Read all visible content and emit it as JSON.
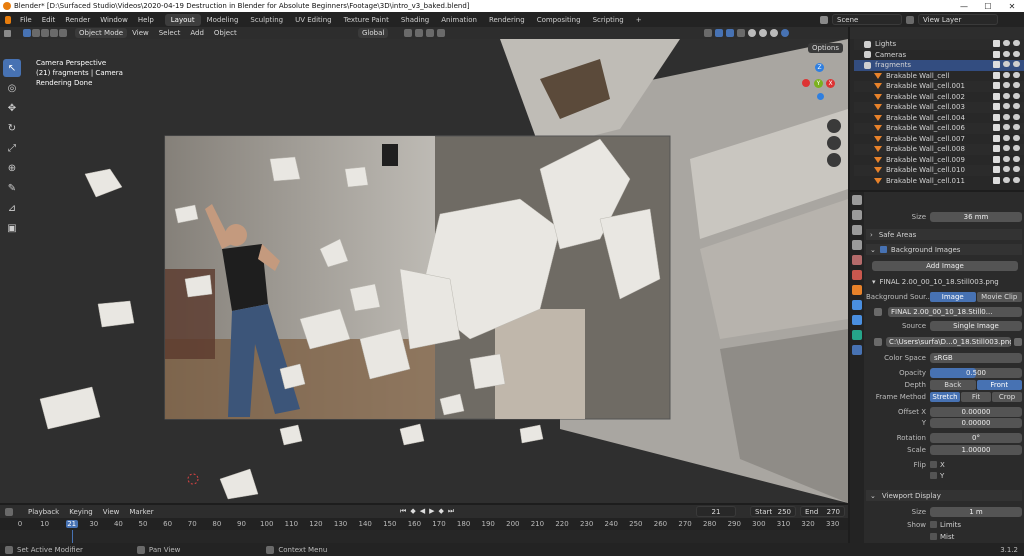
{
  "title_bar": {
    "text": "Blender* [D:\\Surfaced Studio\\Videos\\2020-04-19 Destruction in Blender for Absolute Beginners\\Footage\\3D\\intro_v3_baked.blend]",
    "minimize": "—",
    "maximize": "☐",
    "close": "✕"
  },
  "menu": [
    "File",
    "Edit",
    "Render",
    "Window",
    "Help"
  ],
  "workspaces": [
    "Layout",
    "Modeling",
    "Sculpting",
    "UV Editing",
    "Texture Paint",
    "Shading",
    "Animation",
    "Rendering",
    "Compositing",
    "Scripting"
  ],
  "workspace_add": "+",
  "scene": "Scene",
  "view_layer": "View Layer",
  "viewport_header": {
    "mode": "Object Mode",
    "menus": [
      "View",
      "Select",
      "Add",
      "Object"
    ],
    "transform": "Global",
    "options": "Options"
  },
  "viewport_overlay": {
    "line1": "Camera Perspective",
    "line2": "(21) fragments | Camera",
    "line3": "Rendering Done"
  },
  "gizmo": {
    "z": "Z",
    "y": "Y",
    "x": "X"
  },
  "outliner": {
    "rows": [
      {
        "label": "Lights",
        "type": "collection"
      },
      {
        "label": "Cameras",
        "type": "collection"
      },
      {
        "label": "fragments",
        "type": "collection",
        "selected": true
      },
      {
        "label": "Brakable Wall_cell",
        "type": "mesh"
      },
      {
        "label": "Brakable Wall_cell.001",
        "type": "mesh"
      },
      {
        "label": "Brakable Wall_cell.002",
        "type": "mesh"
      },
      {
        "label": "Brakable Wall_cell.003",
        "type": "mesh"
      },
      {
        "label": "Brakable Wall_cell.004",
        "type": "mesh"
      },
      {
        "label": "Brakable Wall_cell.006",
        "type": "mesh"
      },
      {
        "label": "Brakable Wall_cell.007",
        "type": "mesh"
      },
      {
        "label": "Brakable Wall_cell.008",
        "type": "mesh"
      },
      {
        "label": "Brakable Wall_cell.009",
        "type": "mesh"
      },
      {
        "label": "Brakable Wall_cell.010",
        "type": "mesh"
      },
      {
        "label": "Brakable Wall_cell.011",
        "type": "mesh"
      }
    ]
  },
  "properties": {
    "size_label": "Size",
    "size_value": "36 mm",
    "safe_areas": "Safe Areas",
    "background_images": "Background Images",
    "add_image": "Add Image",
    "image_name": "FINAL 2.00_00_10_18.Still003.png",
    "background_source_label": "Background Sour...",
    "bg_source_options": [
      "Image",
      "Movie Clip"
    ],
    "image_block": "FINAL 2.00_00_10_18.Still0...",
    "source_label": "Source",
    "source_value": "Single Image",
    "filepath": "C:\\Users\\surfa\\D...0_18.Still003.png",
    "color_space_label": "Color Space",
    "color_space_value": "sRGB",
    "opacity_label": "Opacity",
    "opacity_value": "0.500",
    "opacity": 0.5,
    "depth_label": "Depth",
    "depth_options": [
      "Back",
      "Front"
    ],
    "frame_method_label": "Frame Method",
    "frame_method_options": [
      "Stretch",
      "Fit",
      "Crop"
    ],
    "offset_x_label": "Offset X",
    "offset_x_value": "0.00000",
    "offset_y_label": "Y",
    "offset_y_value": "0.00000",
    "rotation_label": "Rotation",
    "rotation_value": "0°",
    "scale_label": "Scale",
    "scale_value": "1.00000",
    "flip_label": "Flip",
    "flip_x": "X",
    "flip_y": "Y",
    "viewport_display": "Viewport Display",
    "vd_size_label": "Size",
    "vd_size_value": "1 m",
    "show_label": "Show",
    "limits": "Limits",
    "mist": "Mist"
  },
  "timeline": {
    "menus": [
      "Playback",
      "Keying",
      "View",
      "Marker"
    ],
    "current_frame": "21",
    "start_label": "Start",
    "start": "250",
    "end_label": "End",
    "end": "270",
    "ticks": [
      "0",
      "10",
      "21",
      "30",
      "40",
      "50",
      "60",
      "70",
      "80",
      "90",
      "100",
      "110",
      "120",
      "130",
      "140",
      "150",
      "160",
      "170",
      "180",
      "190",
      "200",
      "210",
      "220",
      "230",
      "240",
      "250",
      "260",
      "270",
      "280",
      "290",
      "300",
      "310",
      "320",
      "330"
    ]
  },
  "status_bar": {
    "left": "Set Active Modifier",
    "middle": "Pan View",
    "right": "Context Menu",
    "version": "3.1.2"
  },
  "colors": {
    "accent": "#4772b3",
    "selection": "#334d80",
    "frame_indicator": "#4772b3"
  }
}
